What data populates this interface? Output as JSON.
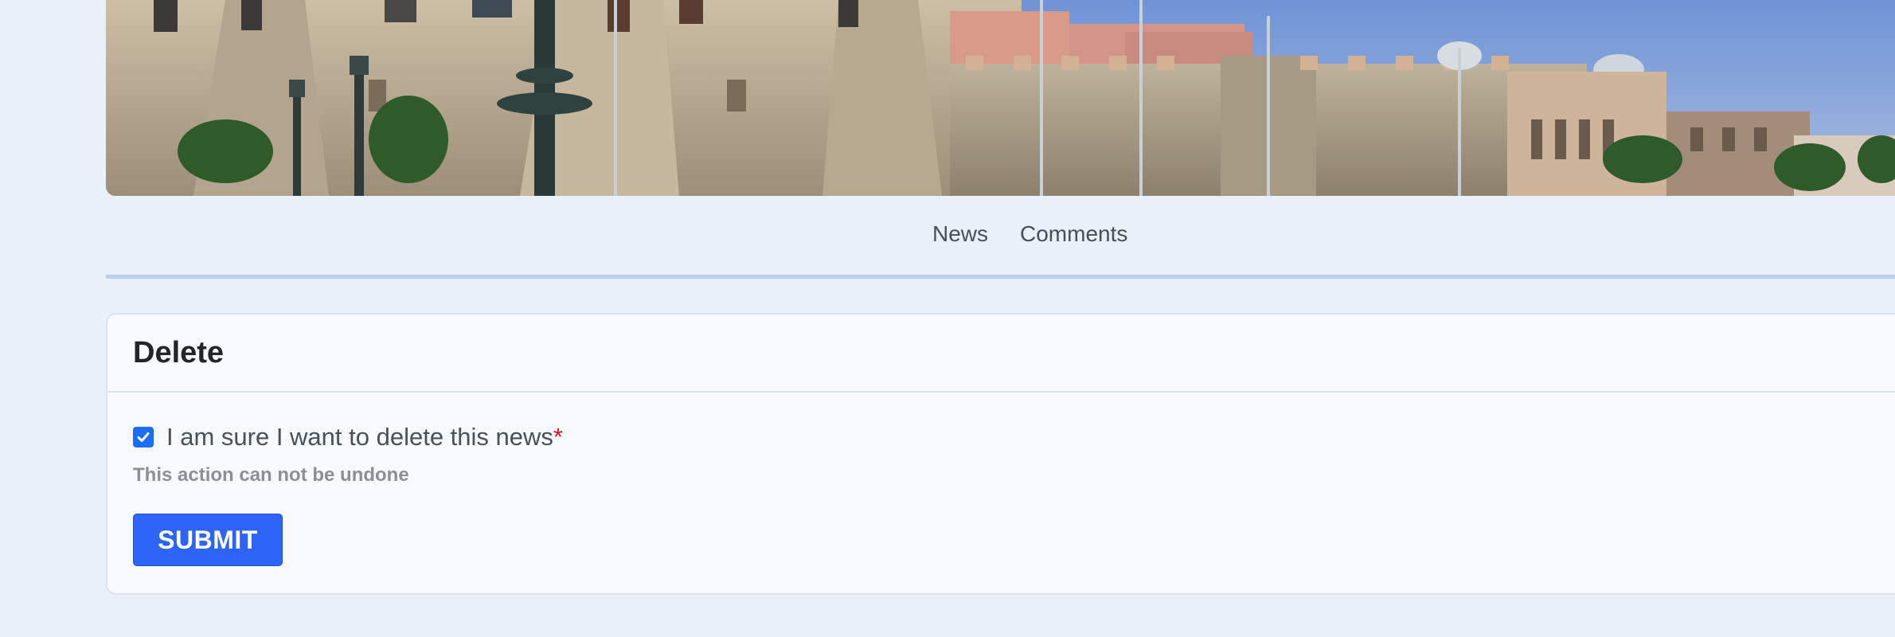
{
  "banner": {
    "alt": "Photo of a historic stone fortress with palm trees and lamp posts"
  },
  "nav": {
    "items": [
      {
        "label": "News"
      },
      {
        "label": "Comments"
      }
    ]
  },
  "form": {
    "title": "Delete",
    "confirm_label": "I am sure I want to delete this news",
    "required_mark": "*",
    "confirm_checked": true,
    "hint": "This action can not be undone",
    "submit_label": "SUBMIT"
  },
  "colors": {
    "background": "#e8f0fa",
    "accent": "#2e64f5",
    "checkbox": "#1b6ef3",
    "required": "#e0151b"
  }
}
